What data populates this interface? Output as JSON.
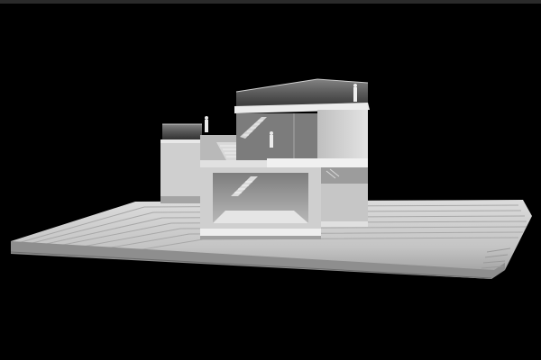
{
  "image": {
    "subject": "architectural-model-photo",
    "background_color": "#000000",
    "frame_bar_color": "#2a2a2a",
    "model_colors": {
      "base_light": "#d9d9d9",
      "base_mid": "#bdbdbd",
      "base_shadow": "#8f8f8f",
      "wall_light": "#e6e6e6",
      "wall_mid": "#c9c9c9",
      "wall_dark": "#9e9e9e",
      "glass": "#8a8a8a"
    }
  }
}
